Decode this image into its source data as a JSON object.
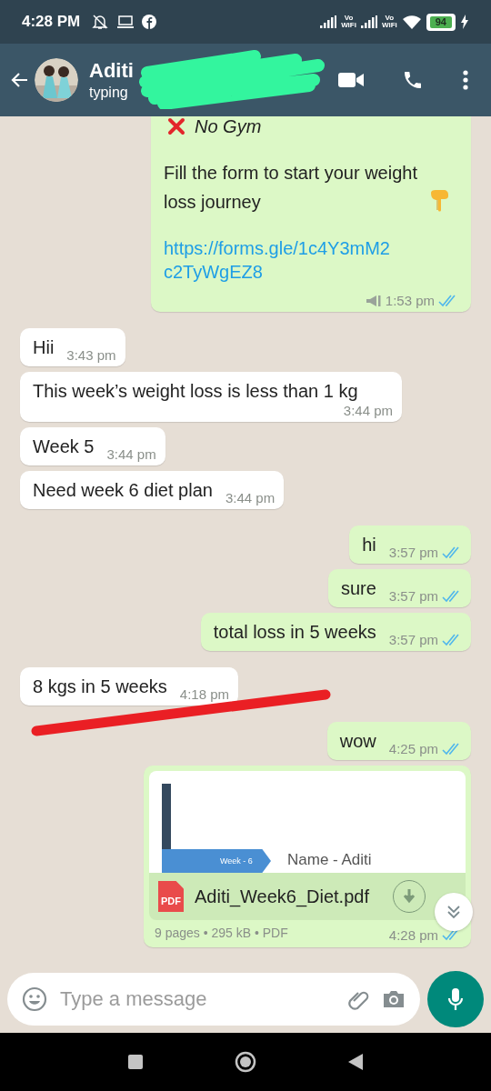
{
  "status_bar": {
    "time": "4:28 PM",
    "sims": [
      {
        "tag_top": "Vo",
        "tag_bottom": "WiFi"
      },
      {
        "tag_top": "Vo",
        "tag_bottom": "WiFi"
      }
    ],
    "battery": "94"
  },
  "header": {
    "name": "Aditi",
    "subtitle": "typing",
    "redacted": true
  },
  "messages": [
    {
      "kind": "rich",
      "outgoing": true,
      "heading": "No Gym",
      "body": "Fill the form to start your weight loss journey",
      "link": "https://forms.gle/1c4Y3mM2c2TyWgEZ8",
      "time": "1:53 pm",
      "broadcast": true,
      "read": true
    },
    {
      "kind": "text",
      "outgoing": false,
      "text": "Hii",
      "time": "3:43 pm"
    },
    {
      "kind": "text",
      "outgoing": false,
      "text": "This week’s weight loss is less than 1 kg",
      "time": "3:44 pm"
    },
    {
      "kind": "text",
      "outgoing": false,
      "text": "Week 5",
      "time": "3:44 pm"
    },
    {
      "kind": "text",
      "outgoing": false,
      "text": "Need week 6 diet plan",
      "time": "3:44 pm"
    },
    {
      "kind": "text",
      "outgoing": true,
      "text": "hi",
      "time": "3:57 pm",
      "read": true
    },
    {
      "kind": "text",
      "outgoing": true,
      "text": "sure",
      "time": "3:57 pm",
      "read": true
    },
    {
      "kind": "text",
      "outgoing": true,
      "text": "total loss in 5 weeks",
      "time": "3:57 pm",
      "read": true
    },
    {
      "kind": "text",
      "outgoing": false,
      "text": "8 kgs in 5 weeks",
      "time": "4:18 pm",
      "struck": true
    },
    {
      "kind": "text",
      "outgoing": true,
      "text": "wow",
      "time": "4:25 pm",
      "read": true
    },
    {
      "kind": "document",
      "outgoing": true,
      "preview_tag": "Week - 6",
      "preview_title": "Name - Aditi",
      "file_type": "PDF",
      "file_name": "Aditi_Week6_Diet.pdf",
      "details": "9 pages • 295 kB • PDF",
      "time": "4:28 pm",
      "read": true
    }
  ],
  "composer": {
    "placeholder": "Type a message"
  }
}
